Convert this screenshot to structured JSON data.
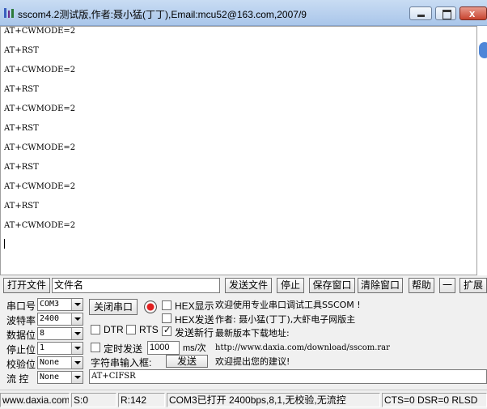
{
  "window": {
    "title": "sscom4.2测试版,作者:聂小猛(丁丁),Email:mcu52@163.com,2007/9",
    "close_glyph": "x"
  },
  "receive": {
    "lines": [
      "AT+CWMODE=2",
      "AT+RST",
      "AT+CWMODE=2",
      "AT+RST",
      "AT+CWMODE=2",
      "AT+RST",
      "AT+CWMODE=2",
      "AT+RST",
      "AT+CWMODE=2",
      "AT+RST",
      "AT+CWMODE=2"
    ]
  },
  "toolbar": {
    "open_file": "打开文件",
    "filename_value": "文件名",
    "send_file": "发送文件",
    "stop": "停止",
    "save_window": "保存窗口",
    "clear_window": "清除窗口",
    "help": "帮助",
    "collapse": "一",
    "expand": "扩展"
  },
  "settings": {
    "port_label": "串口号",
    "port_value": "COM3",
    "baud_label": "波特率",
    "baud_value": "2400",
    "data_label": "数据位",
    "data_value": "8",
    "stop_label": "停止位",
    "stop_value": "1",
    "parity_label": "校验位",
    "parity_value": "None",
    "flow_label": "流 控",
    "flow_value": "None",
    "close_port": "关闭串口",
    "hex_display": "HEX显示",
    "hex_send": "HEX发送",
    "dtr": "DTR",
    "rts": "RTS",
    "send_newline": "发送新行",
    "timed_send": "定时发送",
    "interval_value": "1000",
    "interval_unit": "ms/次",
    "string_input": "字符串输入框:",
    "send": "发送",
    "send_value": "AT+CIFSR"
  },
  "info": {
    "line1": "欢迎使用专业串口调试工具SSCOM !",
    "line2": "作者: 聂小猛(丁丁),大虾电子网版主",
    "line3": "最新版本下载地址:",
    "line4": "http://www.daxia.com/download/sscom.rar",
    "line5": "欢迎提出您的建议!"
  },
  "status": {
    "site": "www.daxia.com",
    "sent": "S:0",
    "received": "R:142",
    "port_state": "COM3已打开  2400bps,8,1,无校验,无流控",
    "lines_state": "CTS=0 DSR=0 RLSD"
  }
}
